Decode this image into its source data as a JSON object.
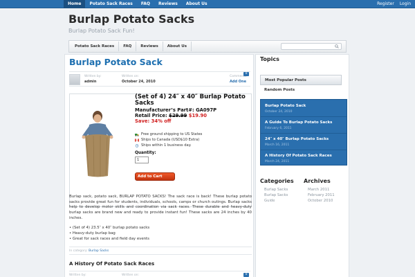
{
  "topbar": {
    "nav": [
      "Home",
      "Potato Sack Races",
      "FAQ",
      "Reviews",
      "About Us"
    ],
    "links": [
      "Register",
      "Login"
    ]
  },
  "site": {
    "title": "Burlap Potato Sacks",
    "tagline": "Burlap Potato Sack Fun!"
  },
  "mainnav": {
    "items": [
      "Potato Sack Races",
      "FAQ",
      "Reviews",
      "About Us"
    ]
  },
  "post": {
    "title": "Burlap Potato Sack",
    "written_by_label": "Written by:",
    "author": "admin",
    "written_on_label": "Written on:",
    "date": "October 24, 2010",
    "comments_label": "Comments",
    "comments_action": "Add One",
    "comments_count": "0"
  },
  "product": {
    "title": "(Set of 4) 24″ x 40″ Burlap Potato Sacks",
    "part_label": "Manufacturer’s Part#:",
    "part": "GA097P",
    "price_label": "Retail Price:",
    "old_price": "$29.99",
    "price": "$19.90",
    "save": "Save: 34% off",
    "ship1": "Free ground shipping to US States",
    "ship2": "Ships to Canada (USD$10 Extra)",
    "ship3": "Ships within 1 business day.",
    "qty_label": "Quantity:",
    "qty": "1",
    "cart": "Add to Cart"
  },
  "description": "Burlap sack, potato sack, BURLAP POTATO SACKS! The sack race is back! These burlap potato sacks provide great fun for students, individuals, schools, camps or church outings. Burlap sacks help to develop motor skills and coordination via sack races. These durable and heavy-duty burlap sacks are brand new and ready to provide instant fun! These sacks are 24 inches by 40 inches.",
  "bullets": [
    "(Set of 4) 23.5″ x 40″ burlap potato sacks",
    "Heavy-duty burlap bag",
    "Great for sack races and field day events"
  ],
  "category": {
    "label": "In category:",
    "value": "Burlap Sacks"
  },
  "post2": {
    "title": "A History Of Potato Sack Races",
    "written_by_label": "Written by:",
    "written_on_label": "Written on:",
    "comments_count": "0"
  },
  "sidebar": {
    "title": "Topics",
    "tabs": [
      "Most Popular Posts",
      "Random Posts"
    ],
    "popular": [
      {
        "title": "Burlap Potato Sack",
        "date": "October 24, 2010"
      },
      {
        "title": "A Guide To Burlap Potato Sacks",
        "date": "February 6, 2011"
      },
      {
        "title": "24″ x 40″ Burlap Potato Sacks",
        "date": "March 16, 2011"
      },
      {
        "title": "A History Of Potato Sack Races",
        "date": "March 24, 2011"
      }
    ],
    "categories_title": "Categories",
    "categories": [
      "Burlap Sacks",
      "Burlap Sacks Guide"
    ],
    "archives_title": "Archives",
    "archives": [
      "March 2011",
      "February 2011",
      "October 2010"
    ]
  }
}
